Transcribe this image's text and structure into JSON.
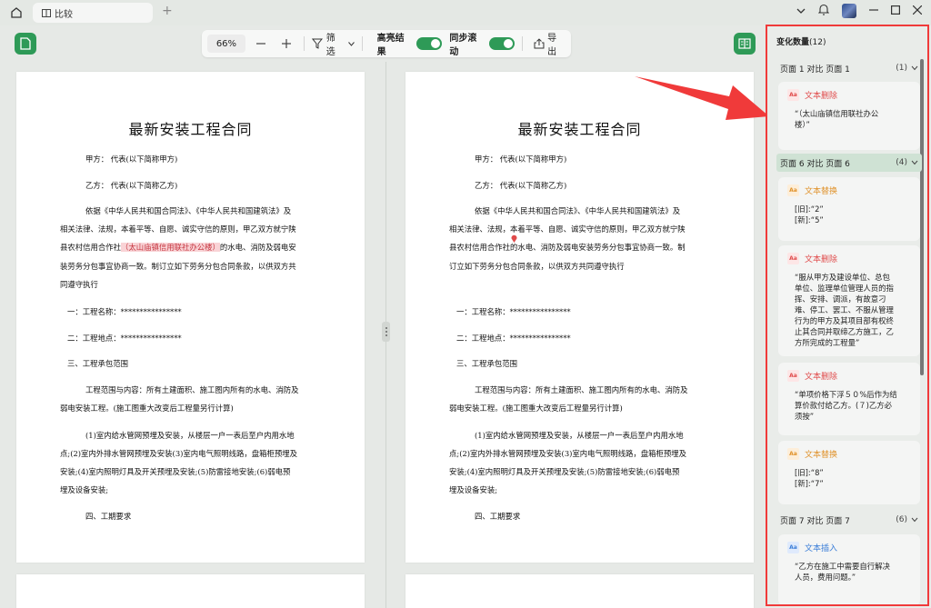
{
  "titlebar": {
    "tab_label": "比较",
    "tab_icon": "compare-icon"
  },
  "toolbar": {
    "zoom": "66%",
    "filter_label": "筛选",
    "highlight_label": "高亮结果",
    "sync_label": "同步滚动",
    "export_label": "导出",
    "accent": "#2e9a57"
  },
  "doc": {
    "title": "最新安装工程合同",
    "party_a": "甲方：  代表(以下简称甲方)",
    "party_b": "乙方：  代表(以下简称乙方)",
    "para1_l1": "依据《中华人民共和国合同法》、《中华人民共和国建筑法》及",
    "para1_l2": "相关法律、法规，本着平等、自愿、诚实守信的原则，甲乙双方就宁陕",
    "para1_l3_pre": "县农村信用合作社",
    "para1_l3_hl": "（太山庙镇信用联社办公楼）",
    "para1_l3_post": "的水电、消防及弱电安",
    "para1_l4": "装劳务分包事宜协商一致。制订立如下劳务分包合同条款，以供双方共",
    "para1_l5": "同遵守执行",
    "r_para1_l3": "县农村信用合作社的水电、消防及弱电安装劳务分包事宜协商一致。制",
    "r_para1_l4": "订立如下劳务分包合同条款，以供双方共同遵守执行",
    "item1": "一：工程名称：****************",
    "item2": "二：工程地点：****************",
    "item3": "三、工程承包范围",
    "scope_l1": "工程范围与内容：所有土建面积、施工图内所有的水电、消防及",
    "scope_l2": "弱电安装工程。(施工图重大改变后工程量另行计算)",
    "sub_l1": "(1)室内给水管网预埋及安装，从楼层一户一表后至户内用水地",
    "sub_l2": "点;(2)室内外排水管网预埋及安装(3)室内电气照明线路，盘箱柜预埋及",
    "sub_l3": "安装;(4)室内照明灯具及开关预埋及安装;(5)防雷接地安装;(6)弱电预",
    "sub_l4": "埋及设备安装;",
    "item4": "四、工期要求"
  },
  "panel": {
    "title": "变化数量",
    "count": "(12)",
    "groups": [
      {
        "label": "页面 1 对比 页面 1",
        "count": "(1)"
      },
      {
        "label": "页面 6 对比 页面 6",
        "count": "(4)"
      },
      {
        "label": "页面 7 对比 页面 7",
        "count": "(6)"
      }
    ],
    "cards": [
      {
        "type": "文本删除",
        "text": "“（太山庙镇信用联社办公\n楼）”"
      },
      {
        "type": "文本替换",
        "text": "[旧]:“2”\n[新]:“5”"
      },
      {
        "type": "文本删除",
        "text": "“服从甲方及建设单位、总包\n单位、监理单位管理人员的指\n挥、安排、调派，有故意刁\n难、停工、罢工、不服从管理\n行为的甲方及其项目部有权终\n止其合同并取缔乙方施工，乙\n方所完成的工程量”"
      },
      {
        "type": "文本删除",
        "text": "“单项价格下浮５０%后作为结\n算价款付给乙方。(７)乙方必\n须按”"
      },
      {
        "type": "文本替换",
        "text": "[旧]:“8”\n[新]:“7”"
      },
      {
        "type": "文本插入",
        "text": "“乙方在施工中需要自行解决\n人员，费用问题。”"
      }
    ],
    "border_color": "#f03a3a"
  }
}
